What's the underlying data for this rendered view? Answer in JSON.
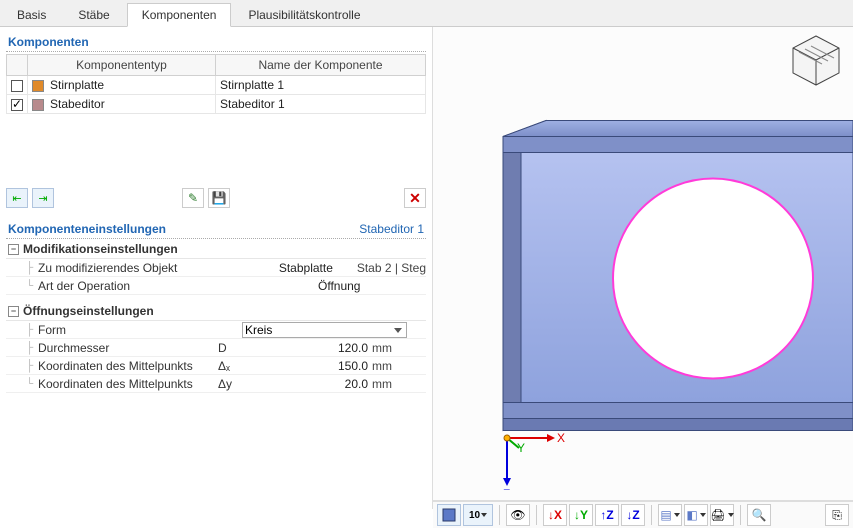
{
  "tabs": {
    "basis": "Basis",
    "staebe": "Stäbe",
    "komponenten": "Komponenten",
    "plausi": "Plausibilitätskontrolle"
  },
  "activeTab": "komponenten",
  "components": {
    "panelTitle": "Komponenten",
    "cols": {
      "type": "Komponententyp",
      "name": "Name der Komponente"
    },
    "rows": [
      {
        "checked": false,
        "swatch": "#e08a2a",
        "type": "Stirnplatte",
        "name": "Stirnplatte 1"
      },
      {
        "checked": true,
        "swatch": "#b88a8c",
        "type": "Stabeditor",
        "name": "Stabeditor 1"
      }
    ]
  },
  "settings": {
    "heading": "Komponenteneinstellungen",
    "objectName": "Stabeditor 1",
    "groups": {
      "mod": {
        "title": "Modifikationseinstellungen",
        "rows": {
          "target": {
            "label": "Zu modifizierendes Objekt",
            "value": "Stabplatte",
            "extra": "Stab 2 | Steg"
          },
          "op": {
            "label": "Art der Operation",
            "value": "Öffnung"
          }
        }
      },
      "opening": {
        "title": "Öffnungseinstellungen",
        "rows": {
          "form": {
            "label": "Form",
            "value": "Kreis"
          },
          "dia": {
            "label": "Durchmesser",
            "sym": "D",
            "value": "120.0",
            "unit": "mm"
          },
          "cx": {
            "label": "Koordinaten des Mittelpunkts",
            "sym": "Δₓ",
            "value": "150.0",
            "unit": "mm"
          },
          "cy": {
            "label": "Koordinaten des Mittelpunkts",
            "sym": "Δy",
            "value": "20.0",
            "unit": "mm"
          }
        }
      }
    }
  },
  "axes": {
    "x": "X",
    "y": "Y",
    "z": "Z"
  },
  "bottomToolbar": {
    "numberLabel": "10"
  }
}
